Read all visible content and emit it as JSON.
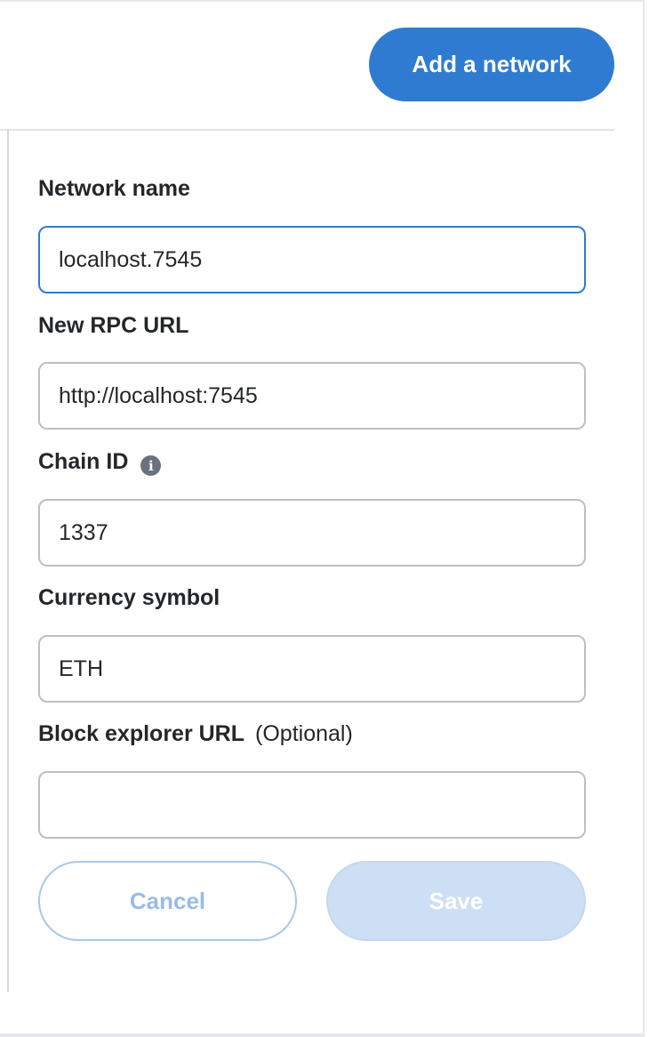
{
  "header": {
    "add_network_label": "Add a network"
  },
  "form": {
    "network_name": {
      "label": "Network name",
      "value": "localhost.7545"
    },
    "rpc_url": {
      "label": "New RPC URL",
      "value": "http://localhost:7545"
    },
    "chain_id": {
      "label": "Chain ID",
      "info_icon": "info-icon",
      "info_glyph": "i",
      "value": "1337"
    },
    "currency_symbol": {
      "label": "Currency symbol",
      "value": "ETH"
    },
    "block_explorer": {
      "label": "Block explorer URL",
      "optional_label": "(Optional)",
      "value": ""
    },
    "cancel_label": "Cancel",
    "save_label": "Save"
  },
  "colors": {
    "primary": "#2f7bd1",
    "focus_border": "#2f7bd1",
    "input_border": "#bbc0c5",
    "disabled_primary": "#cddff4",
    "text": "#24272a"
  }
}
